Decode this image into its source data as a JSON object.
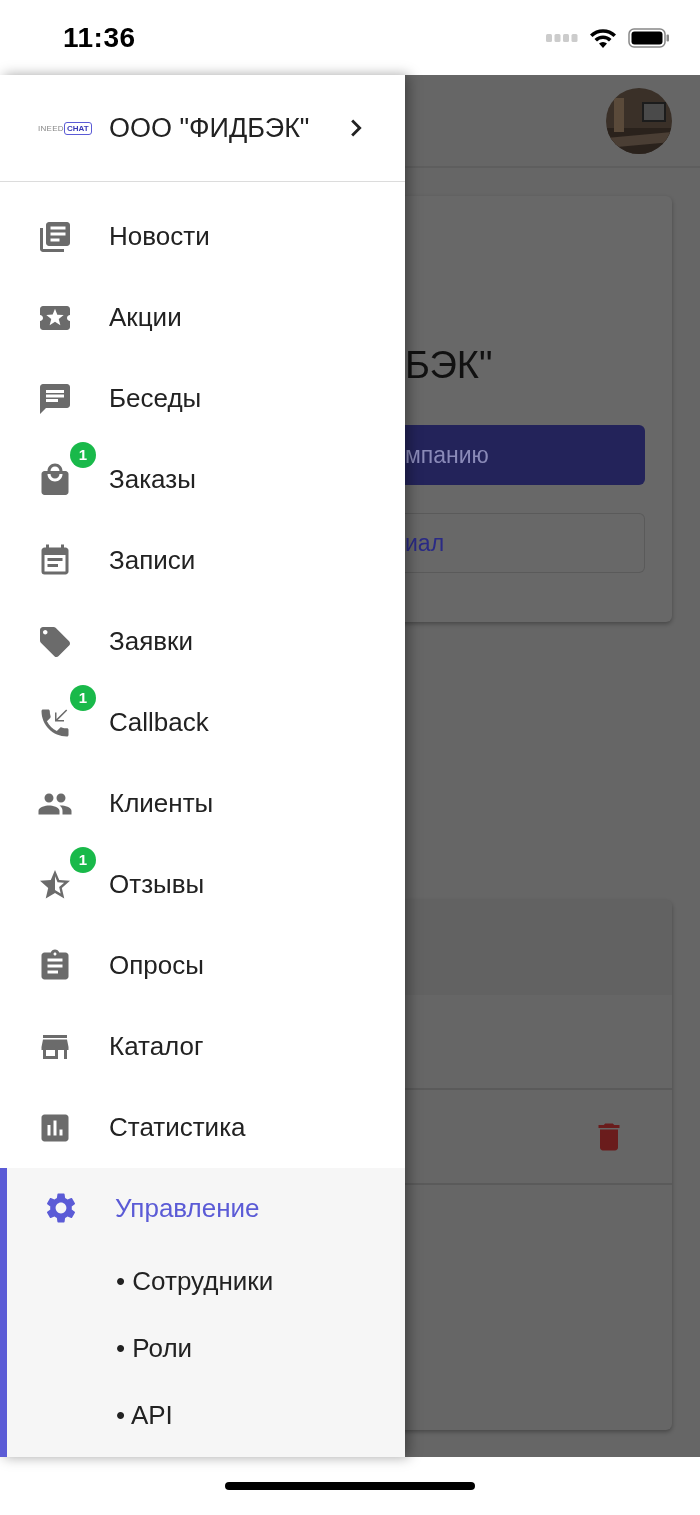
{
  "status_bar": {
    "time": "11:36"
  },
  "drawer": {
    "logo": {
      "left": "INEED",
      "right": "CHAT"
    },
    "company": "ООО \"ФИДБЭК\"",
    "items": [
      {
        "label": "Новости",
        "selected": false
      },
      {
        "label": "Акции",
        "selected": false
      },
      {
        "label": "Беседы",
        "selected": false
      },
      {
        "label": "Заказы",
        "selected": false,
        "badge": "1"
      },
      {
        "label": "Записи",
        "selected": false
      },
      {
        "label": "Заявки",
        "selected": false
      },
      {
        "label": "Callback",
        "selected": false,
        "badge": "1"
      },
      {
        "label": "Клиенты",
        "selected": false
      },
      {
        "label": "Отзывы",
        "selected": false,
        "badge": "1"
      },
      {
        "label": "Опросы",
        "selected": false
      },
      {
        "label": "Каталог",
        "selected": false
      },
      {
        "label": "Статистика",
        "selected": false
      },
      {
        "label": "Управление",
        "selected": true,
        "children": [
          {
            "label": "• Сотрудники"
          },
          {
            "label": "• Роли"
          },
          {
            "label": "• API"
          }
        ]
      }
    ]
  },
  "background": {
    "title": "БЭК\"",
    "primary_button": "мпанию",
    "secondary_button": "иал"
  }
}
